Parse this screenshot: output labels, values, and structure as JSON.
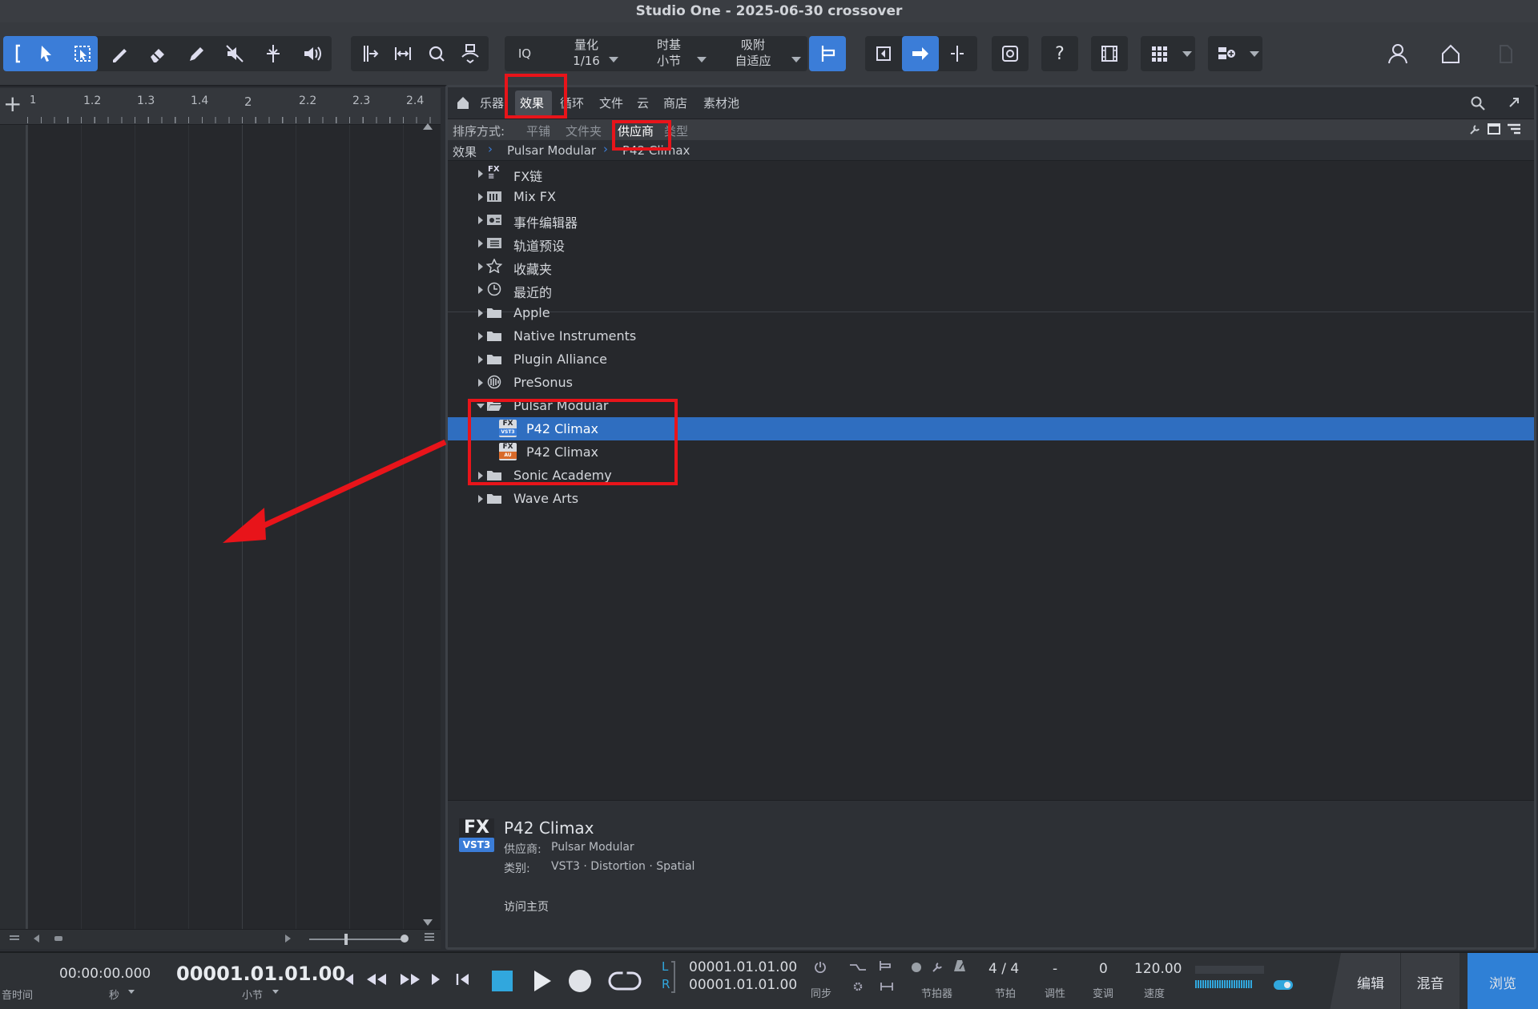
{
  "window": {
    "title": "Studio One - 2025-06-30 crossover"
  },
  "toolbar": {
    "iq_label": "IQ",
    "quantize": {
      "label": "量化",
      "value": "1/16"
    },
    "timebase": {
      "label": "时基",
      "value": "小节"
    },
    "snap": {
      "label": "吸附",
      "value": "自适应"
    },
    "help_label": "?"
  },
  "ruler": {
    "ticks": [
      "1",
      "1.2",
      "1.3",
      "1.4",
      "2",
      "2.2",
      "2.3",
      "2.4"
    ]
  },
  "browser": {
    "tabs": [
      "乐器",
      "效果",
      "循环",
      "文件",
      "云",
      "商店",
      "素材池"
    ],
    "active_tab": "效果",
    "sort": {
      "label": "排序方式:",
      "options": [
        "平铺",
        "文件夹",
        "供应商",
        "类型"
      ],
      "active": "供应商"
    },
    "breadcrumb": [
      "效果",
      "Pulsar Modular",
      "P42 Climax"
    ],
    "items": [
      {
        "label": "FX链",
        "icon": "fx-chain-icon",
        "expanded": false
      },
      {
        "label": "Mix FX",
        "icon": "mixfx-icon",
        "expanded": false
      },
      {
        "label": "事件编辑器",
        "icon": "event-editor-icon",
        "expanded": false
      },
      {
        "label": "轨道预设",
        "icon": "track-preset-icon",
        "expanded": false
      },
      {
        "label": "收藏夹",
        "icon": "star-icon",
        "expanded": false
      },
      {
        "label": "最近的",
        "icon": "clock-icon",
        "expanded": false
      },
      {
        "label": "Apple",
        "icon": "folder-icon",
        "expanded": false
      },
      {
        "label": "Native Instruments",
        "icon": "folder-icon",
        "expanded": false
      },
      {
        "label": "Plugin Alliance",
        "icon": "folder-icon",
        "expanded": false
      },
      {
        "label": "PreSonus",
        "icon": "presonus-icon",
        "expanded": false
      },
      {
        "label": "Pulsar Modular",
        "icon": "folder-open-icon",
        "expanded": true
      },
      {
        "label": "P42 Climax",
        "icon": "fx-vst3-icon",
        "badge": "VST3",
        "selected": true
      },
      {
        "label": "P42 Climax",
        "icon": "fx-au-icon",
        "badge": "AU"
      },
      {
        "label": "Sonic Academy",
        "icon": "folder-icon",
        "expanded": false
      },
      {
        "label": "Wave Arts",
        "icon": "folder-icon",
        "expanded": false
      }
    ],
    "info": {
      "badge_top": "FX",
      "badge_bottom": "VST3",
      "name": "P42 Climax",
      "vendor_label": "供应商:",
      "vendor": "Pulsar Modular",
      "category_label": "类别:",
      "category": "VST3 · Distortion · Spatial",
      "homepage": "访问主页"
    }
  },
  "transport": {
    "audio_time_label": "音时间",
    "time_value": "00:00:00.000",
    "time_unit": "秒",
    "position_value": "00001.01.01.00",
    "position_unit": "小节",
    "loop_L_label": "L",
    "loop_R_label": "R",
    "loop_L": "00001.01.01.00",
    "loop_R": "00001.01.01.00",
    "sync_label": "同步",
    "metronome_label": "节拍器",
    "signature_value": "4 / 4",
    "signature_label": "节拍",
    "key_value": "-",
    "key_label": "调性",
    "transpose_value": "0",
    "transpose_label": "变调",
    "tempo_value": "120.00",
    "tempo_label": "速度"
  },
  "nav": {
    "edit": "编辑",
    "mix": "混音",
    "browse": "浏览",
    "active": "浏览"
  },
  "colors": {
    "accent": "#3b7dd8",
    "selection": "#2f6ec0",
    "annotation": "#e8141a"
  }
}
